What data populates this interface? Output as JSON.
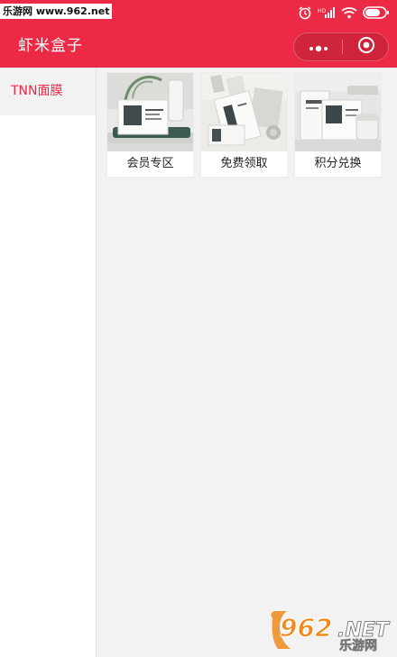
{
  "watermark_top": "乐游网 www.962.net",
  "status_icons": [
    "alarm-icon",
    "signal-icon",
    "wifi-icon",
    "battery-icon"
  ],
  "nav": {
    "title": "虾米盒子",
    "more_icon": "more-dots-icon",
    "close_icon": "target-close-icon"
  },
  "sidebar": {
    "items": [
      {
        "label": "TNN面膜",
        "active": true
      }
    ]
  },
  "products": [
    {
      "label": "会员专区",
      "image": "facial-mask-box-tray-image"
    },
    {
      "label": "免费领取",
      "image": "facial-mask-box-pouch-image"
    },
    {
      "label": "积分兑换",
      "image": "facial-mask-box-jar-image"
    }
  ],
  "watermark_bottom": {
    "number": "962",
    "suffix": ".NET",
    "sub": "乐游网"
  },
  "colors": {
    "brand": "#ec2a45",
    "background": "#f2f2f2",
    "accent_orange": "#f08a1c"
  }
}
